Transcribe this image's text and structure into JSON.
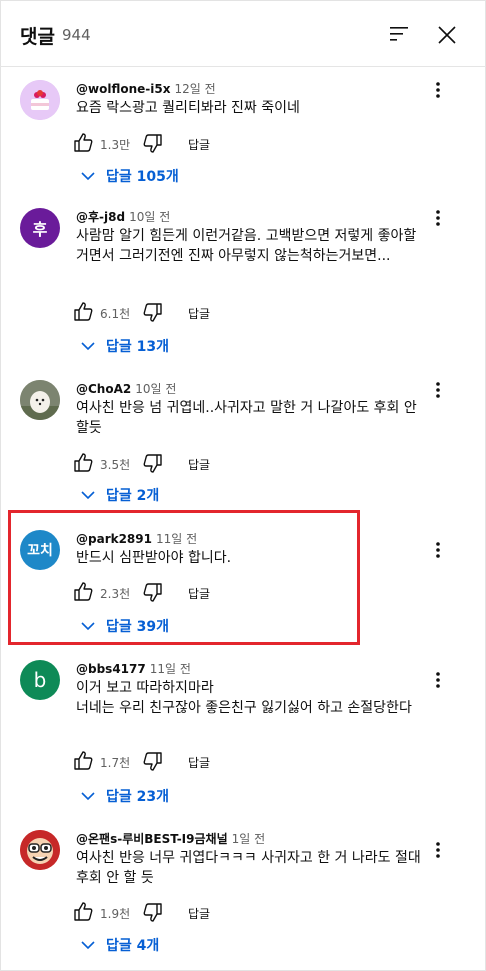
{
  "header": {
    "title": "댓글",
    "count": "944"
  },
  "comments": [
    {
      "author": "@wolflone-i5x",
      "time": "12일 전",
      "text": "요즘 락스광고 퀄리티봐라 진짜 죽이네",
      "likes": "1.3만",
      "reply_label": "답글",
      "replies": "답글 105개",
      "avatar_letter": "",
      "avatar_color": "#d7b8f0"
    },
    {
      "author": "@후-j8d",
      "time": "10일 전",
      "text": "사람맘 알기 힘든게 이런거같음. 고백받으면 저렇게 좋아할거면서 그러기전엔 진짜 아무렇지 않는척하는거보면...",
      "likes": "6.1천",
      "reply_label": "답글",
      "replies": "답글 13개",
      "avatar_letter": "후",
      "avatar_color": "#6a1b9a"
    },
    {
      "author": "@ChoA2",
      "time": "10일 전",
      "text": "여사친 반응 넘 귀엽네..사귀자고 말한 거 나갈아도 후회 안할듯",
      "likes": "3.5천",
      "reply_label": "답글",
      "replies": "답글 2개",
      "avatar_letter": "",
      "avatar_color": "#8a8f7a"
    },
    {
      "author": "@park2891",
      "time": "11일 전",
      "text": "반드시 심판받아야 합니다.",
      "likes": "2.3천",
      "reply_label": "답글",
      "replies": "답글 39개",
      "avatar_letter": "꼬치",
      "avatar_color": "#1e88c8"
    },
    {
      "author": "@bbs4177",
      "time": "11일 전",
      "text": "이거 보고 따라하지마라\n너네는 우리 친구잖아 좋은친구 잃기싫어 하고 손절당한다",
      "likes": "1.7천",
      "reply_label": "답글",
      "replies": "답글 23개",
      "avatar_letter": "b",
      "avatar_color": "#0e8a57"
    },
    {
      "author": "@온팬s-루비BEST-I9금채널",
      "time": "1일 전",
      "text": "여사친 반응 너무 귀엽다ㅋㅋㅋ 사귀자고 한 거 나라도 절대 후회 안 할 듯",
      "likes": "1.9천",
      "reply_label": "답글",
      "replies": "답글 4개",
      "avatar_letter": "",
      "avatar_color": "#d32f2f"
    }
  ],
  "colors": {
    "accent": "#065fd4",
    "highlight": "#e3262d"
  }
}
